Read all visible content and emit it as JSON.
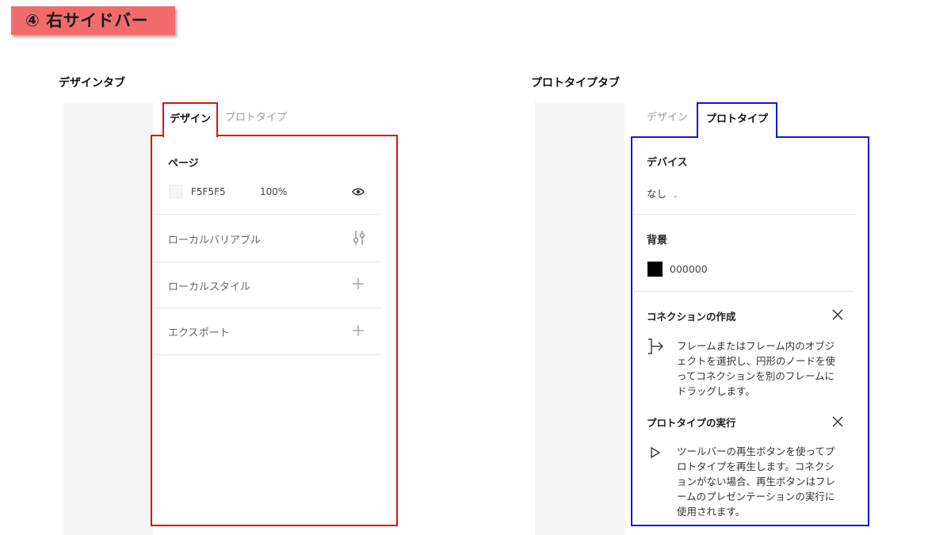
{
  "header": {
    "badge": "④ 右サイドバー"
  },
  "design_section": {
    "label": "デザインタブ",
    "tabs": {
      "active": "デザイン",
      "inactive": "プロトタイプ"
    },
    "page": {
      "title": "ページ",
      "color": "F5F5F5",
      "opacity": "100%",
      "swatch_color": "#F5F5F5"
    },
    "rows": [
      {
        "label": "ローカルバリアブル",
        "icon": "sliders-icon"
      },
      {
        "label": "ローカルスタイル",
        "icon": "plus-icon"
      },
      {
        "label": "エクスポート",
        "icon": "plus-icon"
      }
    ],
    "highlight_color": "#E01010"
  },
  "prototype_section": {
    "label": "プロトタイプタブ",
    "tabs": {
      "inactive": "デザイン",
      "active": "プロトタイプ"
    },
    "device": {
      "title": "デバイス",
      "value": "なし"
    },
    "background": {
      "title": "背景",
      "color": "000000",
      "swatch_color": "#000000"
    },
    "connection": {
      "title": "コネクションの作成",
      "lines": [
        "フレームまたはフレーム内のオブジ",
        "ェクトを選択し、円形のノードを使",
        "ってコネクションを別のフレームに",
        "ドラッグします。"
      ]
    },
    "run": {
      "title": "プロトタイプの実行",
      "lines": [
        "ツールバーの再生ボタンを使ってプ",
        "ロトタイプを再生します。コネクシ",
        "ョンがない場合、再生ボタンはフレ",
        "ームのプレゼンテーションの実行に",
        "使用されます。"
      ]
    },
    "highlight_color": "#1018D8"
  }
}
